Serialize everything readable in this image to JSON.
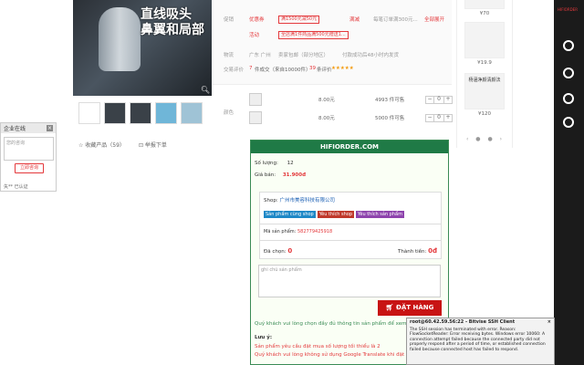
{
  "chat": {
    "title": "企业在线",
    "close": "×",
    "placeholder": "您的咨询",
    "button": "立即咨询",
    "note": "矢** 已认证"
  },
  "product_image": {
    "overlay_text_line1": "直线吸头",
    "overlay_text_line2": "鼻翼和局部",
    "zoom_icon": "magnifier-icon"
  },
  "actions": {
    "favorite": "☆ 收藏产品（59）",
    "report": "⊡ 举报下单"
  },
  "info": {
    "promo_label": "促销",
    "coupon_tag1": "优惠券",
    "coupon_text1": "满1500元减50元",
    "coupon_tag2": "满减",
    "coupon_text2": "每笔订单满300元...",
    "coupon_more": "全部展开",
    "promo2_label": "活动",
    "promo2_text": "全店满1件商品满500元赠送1...",
    "shipping_label": "物流",
    "shipping_from": "广东 广州",
    "shipping_free": "卖家包邮（部分地区）",
    "shipping_time": "付款成功后48小时内发货",
    "sales_label": "交易评价",
    "sales_count": "7",
    "sales_text": "件成交（来自10000件）",
    "rating_count": "39",
    "rating_text": "条评价",
    "stars": "★★★★★"
  },
  "sku": {
    "label": "颜色",
    "rows": [
      {
        "price": "8.00元",
        "stock": "4993 件可售",
        "qty": "0"
      },
      {
        "price": "8.00元",
        "stock": "5000 件可售",
        "qty": "0"
      }
    ]
  },
  "related": {
    "items": [
      {
        "price": "¥70"
      },
      {
        "price": "¥19.9"
      },
      {
        "price": "¥120"
      }
    ],
    "name2": "杨涵净颜清颜法",
    "dots": "‹ ● ● ›"
  },
  "hifi": {
    "title": "HIFIORDER.COM",
    "qty_label": "Số lượng:",
    "qty_value": "12",
    "price_label": "Giá bán:",
    "price_value": "31.900đ",
    "shop_label": "Shop:",
    "shop_name": "广州市美容科技有限公司",
    "btn_same": "Sản phẩm cùng shop",
    "btn_like_shop": "Yêu thích shop",
    "btn_like_product": "Yêu thích sản phẩm",
    "code_label": "Mã sản phẩm:",
    "code_value": "582779425918",
    "selected_label": "Đã chọn:",
    "selected_value": "0",
    "total_label": "Thành tiền:",
    "total_value": "0đ",
    "note_placeholder": "ghi chú sản phẩm",
    "order_button": "ĐẶT HÀNG",
    "fill_warning": "Quý khách vui lòng chọn đầy đủ thông tin sản phẩm để xem giá chuẩn",
    "note_title": "Lưu ý:",
    "note_1": "Sản phẩm yêu cầu đặt mua số lượng tối thiểu là 2",
    "note_2": "Quý khách vui lòng không sử dụng Google Translate khi đặt hàng"
  },
  "ssh": {
    "title": "root@60.42.59.56:22 - Bitvise SSH Client",
    "body": "The SSH session has terminated with error. Reason: FlowSocketReader: Error receiving bytes. Windows error 10060: A connection attempt failed because the connected party did not properly respond after a period of time, or established connection failed because connected host has failed to respond."
  },
  "sidebar_brand": "HIFIORDER"
}
